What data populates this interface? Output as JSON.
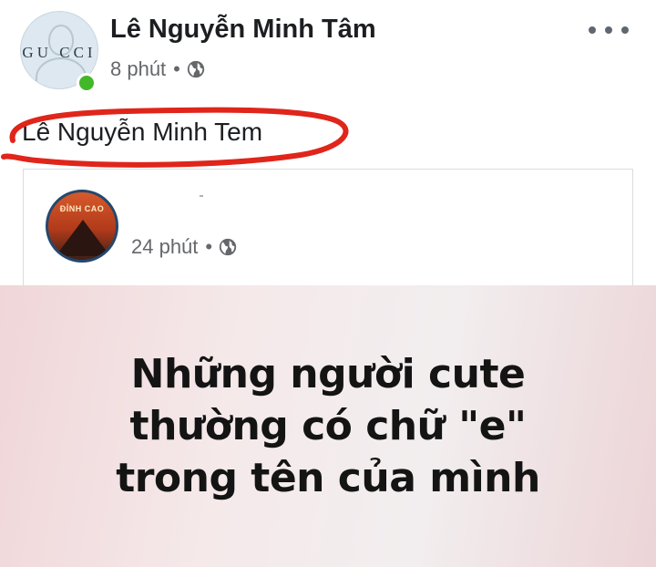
{
  "post": {
    "author_name": "Lê Nguyễn Minh Tâm",
    "avatar_brand": "GU CCI",
    "time": "8 phút",
    "separator": "•",
    "text": "Lê Nguyễn Minh Tem",
    "privacy_icon": "globe-icon",
    "more_icon": "more-horizontal-icon"
  },
  "shared": {
    "page_logo_text": "ĐỈNH CAO",
    "time": "24 phút",
    "separator": "•",
    "privacy_icon": "globe-icon"
  },
  "meme": {
    "lines": [
      "Những người cute",
      "thường có chữ \"e\"",
      "trong tên của mình"
    ]
  },
  "colors": {
    "name_text": "#1c1e21",
    "meta_text": "#65676b",
    "online_dot": "#42b72a",
    "annotation_circle": "#e0251b"
  }
}
